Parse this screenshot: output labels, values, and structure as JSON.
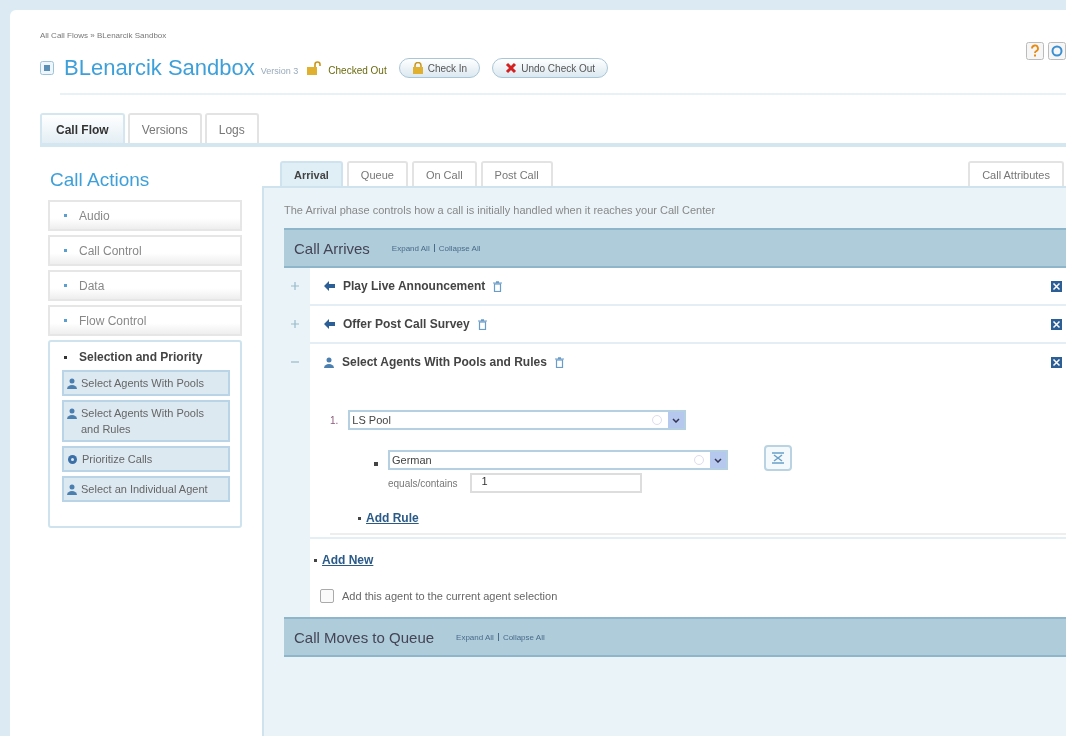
{
  "breadcrumb": "All Call Flows » BLenarcik Sandbox",
  "title": "BLenarcik Sandbox",
  "version": "Version 3",
  "status": "Checked Out",
  "header_buttons": [
    {
      "label": "Check In",
      "kind": "checkin"
    },
    {
      "label": "Undo Check Out",
      "kind": "undo"
    }
  ],
  "tabs": [
    {
      "label": "Call Flow",
      "selected": true
    },
    {
      "label": "Versions",
      "selected": false
    },
    {
      "label": "Logs",
      "selected": false
    }
  ],
  "call_actions": {
    "title": "Call Actions",
    "items": [
      {
        "label": "Audio",
        "expanded": false
      },
      {
        "label": "Call Control",
        "expanded": false
      },
      {
        "label": "Data",
        "expanded": false
      },
      {
        "label": "Flow Control",
        "expanded": false
      },
      {
        "label": "Selection and Priority",
        "expanded": true,
        "children": [
          {
            "label": "Select Agents With Pools",
            "kind": "agent"
          },
          {
            "label": "Select Agents With Pools and Rules",
            "kind": "agent"
          },
          {
            "label": "Prioritize Calls",
            "kind": "priority"
          },
          {
            "label": "Select an Individual Agent",
            "kind": "agent"
          }
        ]
      }
    ]
  },
  "phase_tabs": [
    {
      "label": "Arrival",
      "selected": true
    },
    {
      "label": "Queue",
      "selected": false
    },
    {
      "label": "On Call",
      "selected": false
    },
    {
      "label": "Post Call",
      "selected": false
    }
  ],
  "call_attributes": "Call Attributes",
  "description": "The Arrival phase controls how a call is initially handled when it reaches your Call Center",
  "sections": [
    {
      "title": "Call Arrives",
      "expand_all": "Expand All",
      "collapse_all": "Collapse All",
      "actions": [
        {
          "label": "Play Live Announcement",
          "kind": "announce",
          "expanded": false
        },
        {
          "label": "Offer Post Call Survey",
          "kind": "announce",
          "expanded": false
        },
        {
          "label": "Select Agents With Pools and Rules",
          "kind": "agent",
          "expanded": true,
          "pool_number": "1.",
          "pool": "LS Pool",
          "rule": "German",
          "operator": "equals/contains",
          "rule_value": "1",
          "add_rule": "Add Rule"
        }
      ],
      "add_new": "Add New",
      "checkbox": {
        "label": "Add this agent to the current agent selection",
        "checked": false
      }
    },
    {
      "title": "Call Moves to Queue",
      "expand_all": "Expand All",
      "collapse_all": "Collapse All"
    }
  ]
}
